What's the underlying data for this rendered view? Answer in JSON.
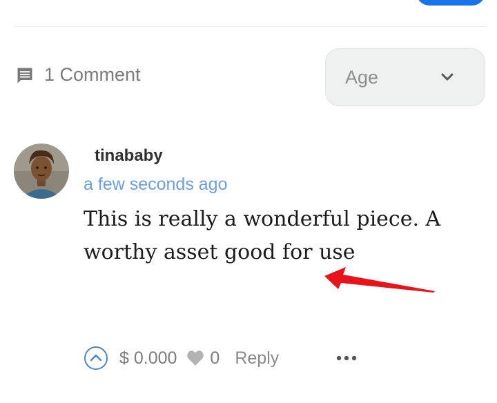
{
  "comments_header": {
    "count_label": "1 Comment",
    "icon": "comment-icon"
  },
  "sort": {
    "selected": "Age",
    "icon": "chevron-down-icon"
  },
  "comment": {
    "author": "tinababy",
    "timestamp": "a few seconds ago",
    "body": "This is really a wonderful piece. A worthy asset good for use",
    "amount": "$ 0.000",
    "likes": "0",
    "reply_label": "Reply",
    "upvote_icon": "upvote-chevron-icon",
    "like_icon": "heart-icon",
    "more_icon": "more-options-icon"
  },
  "colors": {
    "accent_blue": "#1a73e8",
    "timestamp_blue": "#6a9ee6",
    "annotation_red": "#e8141b",
    "muted_text": "#7c7c7c"
  }
}
